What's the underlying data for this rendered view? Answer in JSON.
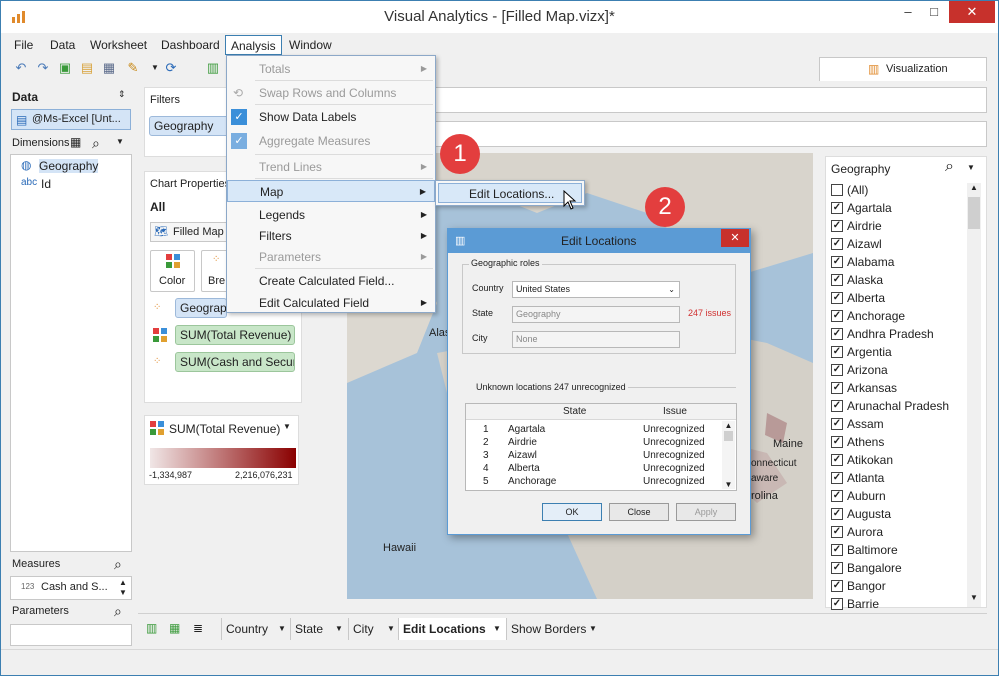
{
  "window": {
    "title": "Visual Analytics - [Filled Map.vizx]*",
    "min": "–",
    "max": "□",
    "close": "✕"
  },
  "menubar": [
    "File",
    "Data",
    "Worksheet",
    "Dashboard",
    "Analysis",
    "Window"
  ],
  "data_panel": {
    "title": "Data",
    "source": "@Ms-Excel [Unt...",
    "dimensions_label": "Dimensions",
    "dimensions": [
      {
        "type": "globe",
        "name": "Geography"
      },
      {
        "type": "abc",
        "name": "Id"
      }
    ],
    "measures_label": "Measures",
    "measure_item": "Cash and S...",
    "measure_type": "123",
    "parameters_label": "Parameters"
  },
  "filters": {
    "label": "Filters",
    "pill": "Geography"
  },
  "chart_properties": {
    "label": "Chart Properties",
    "all": "All",
    "chart_type": "Filled Map",
    "color_btn": "Color",
    "breakdown_btn": "Bre",
    "pills": [
      "Geograph",
      "SUM(Total Revenue)",
      "SUM(Cash and Secur..."
    ]
  },
  "legend": {
    "title": "SUM(Total Revenue)",
    "min": "-1,334,987",
    "max": "2,216,076,231"
  },
  "tab": {
    "visualization": "Visualization"
  },
  "analysis_menu": {
    "items": [
      {
        "label": "Totals",
        "disabled": true,
        "sub": true
      },
      {
        "label": "Swap Rows and Columns",
        "disabled": true
      },
      {
        "label": "Show Data Labels",
        "checked": true
      },
      {
        "label": "Aggregate Measures",
        "disabled": true,
        "checked": true
      },
      {
        "label": "Trend Lines",
        "disabled": true,
        "sub": true
      },
      {
        "label": "Map",
        "sub": true
      },
      {
        "label": "Legends",
        "sub": true
      },
      {
        "label": "Filters",
        "sub": true
      },
      {
        "label": "Parameters",
        "disabled": true,
        "sub": true
      },
      {
        "label": "Create Calculated Field..."
      },
      {
        "label": "Edit Calculated Field",
        "sub": true
      }
    ]
  },
  "map_submenu": {
    "item": "Edit Locations..."
  },
  "badges": [
    "1",
    "2"
  ],
  "map_labels": {
    "alaska": "Alas",
    "hawaii": "Hawaii",
    "maine": "Maine",
    "connecticut": "onnecticut",
    "carolina": "rolina",
    "delaware": "aware"
  },
  "dialog": {
    "title": "Edit Locations",
    "group": "Geographic roles",
    "country_label": "Country",
    "country_value": "United States",
    "state_label": "State",
    "state_value": "Geography",
    "issues": "247 issues",
    "city_label": "City",
    "city_value": "None",
    "unknown": "Unknown locations  247 unrecognized",
    "col_state": "State",
    "col_issue": "Issue",
    "rows": [
      [
        "1",
        "Agartala",
        "Unrecognized"
      ],
      [
        "2",
        "Airdrie",
        "Unrecognized"
      ],
      [
        "3",
        "Aizawl",
        "Unrecognized"
      ],
      [
        "4",
        "Alberta",
        "Unrecognized"
      ],
      [
        "5",
        "Anchorage",
        "Unrecognized"
      ]
    ],
    "ok": "OK",
    "close": "Close",
    "apply": "Apply"
  },
  "right_panel": {
    "title": "Geography",
    "items": [
      "(All)",
      "Agartala",
      "Airdrie",
      "Aizawl",
      "Alabama",
      "Alaska",
      "Alberta",
      "Anchorage",
      "Andhra Pradesh",
      "Argentia",
      "Arizona",
      "Arkansas",
      "Arunachal Pradesh",
      "Assam",
      "Athens",
      "Atikokan",
      "Atlanta",
      "Auburn",
      "Augusta",
      "Aurora",
      "Baltimore",
      "Bangalore",
      "Bangor",
      "Barrie"
    ]
  },
  "bottom_tabs": [
    "Country",
    "State",
    "City",
    "Edit Locations",
    "Show Borders"
  ]
}
